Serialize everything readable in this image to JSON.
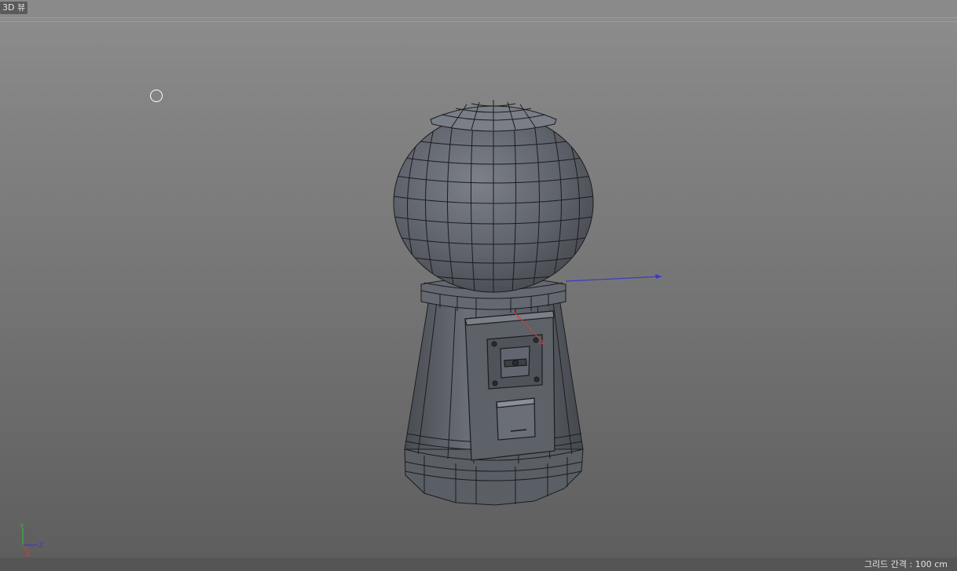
{
  "view": {
    "label": "3D 뷰"
  },
  "status": {
    "grid_spacing": "그리드 간격 : 100 cm"
  },
  "gizmo": {
    "y": "Y",
    "z": "Z",
    "x": "X"
  },
  "colors": {
    "mesh_fill": "#5b5f66",
    "wire": "#1b1c1f",
    "axis_x": "#d43a3a",
    "axis_y": "#3fae3f",
    "axis_z": "#3a3ac9"
  },
  "icons": {
    "cursor": "circle-cursor-icon"
  }
}
